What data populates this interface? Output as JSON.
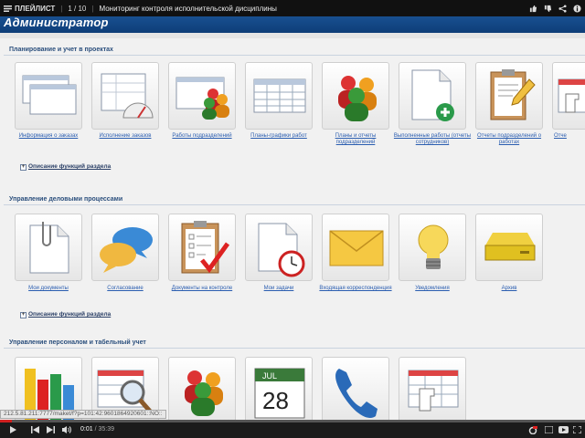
{
  "player": {
    "playlist_label": "ПЛЕЙЛИСТ",
    "position": "1 / 10",
    "video_title": "Мониторинг контроля исполнительской дисциплины",
    "time_current": "0:01",
    "time_total": "35:39",
    "progress_fraction": 0.0005,
    "status_url": "212.5.81.211:7777/maket/f?p=101:42:9601864920601::NO::"
  },
  "app": {
    "title": "Администратор"
  },
  "sections": [
    {
      "title": "Планирование и учет в проектах",
      "tiles": [
        {
          "icon": "windows-icon",
          "label": "Информация о заказах"
        },
        {
          "icon": "gauge-icon",
          "label": "Исполнение заказов"
        },
        {
          "icon": "team-window-icon",
          "label": "Работы подразделений"
        },
        {
          "icon": "schedule-grid-icon",
          "label": "Планы-графики работ"
        },
        {
          "icon": "people-icon",
          "label": "Планы и отчеты подразделений"
        },
        {
          "icon": "document-add-icon",
          "label": "Выполненные работы (отчеты сотрудников)"
        },
        {
          "icon": "clipboard-pencil-icon",
          "label": "Отчеты подразделений о работах"
        },
        {
          "icon": "table-hand-icon",
          "label": "Отче"
        }
      ],
      "desc_link": "Описание функций раздела"
    },
    {
      "title": "Управление деловыми процессами",
      "tiles": [
        {
          "icon": "document-clip-icon",
          "label": "Мои документы"
        },
        {
          "icon": "chat-bubbles-icon",
          "label": "Согласование"
        },
        {
          "icon": "checklist-icon",
          "label": "Документы на контроле"
        },
        {
          "icon": "document-clock-icon",
          "label": "Мои задачи"
        },
        {
          "icon": "envelope-icon",
          "label": "Входящая корреспонденция"
        },
        {
          "icon": "lightbulb-icon",
          "label": "Уведомления"
        },
        {
          "icon": "archive-drive-icon",
          "label": "Архив"
        }
      ],
      "desc_link": "Описание функций раздела"
    },
    {
      "title": "Управление персоналом и табельный учет",
      "tiles": [
        {
          "icon": "bar-chart-icon",
          "label": ""
        },
        {
          "icon": "magnifier-grid-icon",
          "label": ""
        },
        {
          "icon": "people-icon",
          "label": ""
        },
        {
          "icon": "calendar-icon",
          "label": ""
        },
        {
          "icon": "phone-icon",
          "label": ""
        },
        {
          "icon": "table-hand-icon",
          "label": ""
        }
      ],
      "calendar": {
        "month": "JUL",
        "day": "28"
      }
    }
  ]
}
